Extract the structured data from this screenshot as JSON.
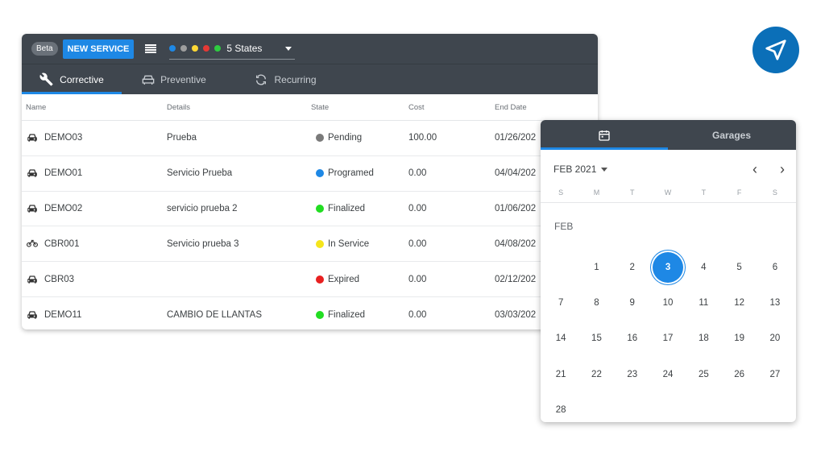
{
  "toolbar": {
    "beta_label": "Beta",
    "new_service_label": "NEW SERVICE",
    "state_dots": [
      "#1e88e5",
      "#9e9e9e",
      "#fdd835",
      "#e53935",
      "#2ecc40"
    ],
    "states_label": "5 States"
  },
  "tabs": [
    {
      "label": "Corrective",
      "icon": "tools-icon"
    },
    {
      "label": "Preventive",
      "icon": "car-front-icon"
    },
    {
      "label": "Recurring",
      "icon": "refresh-icon"
    }
  ],
  "table": {
    "headers": [
      "Name",
      "Details",
      "State",
      "Cost",
      "End Date"
    ],
    "rows": [
      {
        "vehicle": "car",
        "name": "DEMO03",
        "details": "Prueba",
        "state": "Pending",
        "state_color": "#7a7a7a",
        "cost": "100.00",
        "end_date": "01/26/202"
      },
      {
        "vehicle": "car",
        "name": "DEMO01",
        "details": "Servicio Prueba",
        "state": "Programed",
        "state_color": "#1e88e5",
        "cost": "0.00",
        "end_date": "04/04/202"
      },
      {
        "vehicle": "car",
        "name": "DEMO02",
        "details": "servicio prueba 2",
        "state": "Finalized",
        "state_color": "#22dd22",
        "cost": "0.00",
        "end_date": "01/06/202"
      },
      {
        "vehicle": "motorcycle",
        "name": "CBR001",
        "details": "Servicio prueba 3",
        "state": "In Service",
        "state_color": "#f5e51b",
        "cost": "0.00",
        "end_date": "04/08/202"
      },
      {
        "vehicle": "car",
        "name": "CBR03",
        "details": "",
        "state": "Expired",
        "state_color": "#e82020",
        "cost": "0.00",
        "end_date": "02/12/202"
      },
      {
        "vehicle": "car",
        "name": "DEMO11",
        "details": "CAMBIO DE LLANTAS",
        "state": "Finalized",
        "state_color": "#22dd22",
        "cost": "0.00",
        "end_date": "03/03/202"
      }
    ]
  },
  "calendar": {
    "tab_calendar_icon": "calendar-icon",
    "tab_garages": "Garages",
    "month_label": "FEB 2021",
    "prev": "‹",
    "next": "›",
    "weekdays": [
      "S",
      "M",
      "T",
      "W",
      "T",
      "F",
      "S"
    ],
    "section_label": "FEB",
    "weeks": [
      [
        "",
        "1",
        "2",
        "3",
        "4",
        "5",
        "6"
      ],
      [
        "7",
        "8",
        "9",
        "10",
        "11",
        "12",
        "13"
      ],
      [
        "14",
        "15",
        "16",
        "17",
        "18",
        "19",
        "20"
      ],
      [
        "21",
        "22",
        "23",
        "24",
        "25",
        "26",
        "27"
      ],
      [
        "28",
        "",
        "",
        "",
        "",
        "",
        ""
      ]
    ],
    "selected_day": "3"
  },
  "brand": {
    "logo_icon": "paper-plane-icon",
    "color": "#0b6fb8"
  }
}
